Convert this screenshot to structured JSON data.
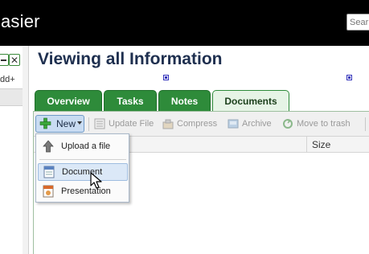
{
  "app": {
    "title_fragment": "asier",
    "search_placeholder": "Sear"
  },
  "left_panel": {
    "add_label": "dd+"
  },
  "page": {
    "title": "Viewing all Information"
  },
  "tabs": [
    {
      "label": "Overview",
      "active": false
    },
    {
      "label": "Tasks",
      "active": false
    },
    {
      "label": "Notes",
      "active": false
    },
    {
      "label": "Documents",
      "active": true
    }
  ],
  "toolbar": {
    "new_label": "New",
    "update_label": "Update File",
    "compress_label": "Compress",
    "archive_label": "Archive",
    "trash_label": "Move to trash"
  },
  "table": {
    "headers": [
      "Size"
    ]
  },
  "menu": {
    "items": [
      {
        "label": "Upload a file",
        "icon": "upload-arrow-icon"
      },
      {
        "label": "Document",
        "icon": "document-icon",
        "hovered": true
      },
      {
        "label": "Presentation",
        "icon": "presentation-icon"
      }
    ]
  },
  "colors": {
    "topbar": "#000000",
    "tab_green": "#2e8b3a",
    "tab_active_bg": "#e6f4e6",
    "title": "#1e2f4f",
    "new_button": "#c9dcf2"
  }
}
